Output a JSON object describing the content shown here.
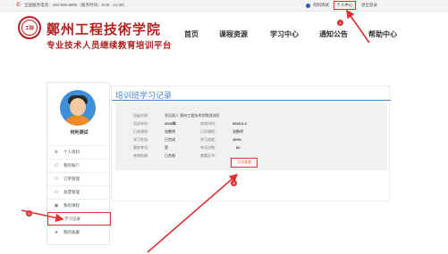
{
  "topbar": {
    "hotline": "全国服务电话：400-900-6896（服务时间：8:00 - 21:00）",
    "username": "何利测试",
    "personal_center": "个人中心",
    "logout": "退出登录"
  },
  "header": {
    "logo_seal_text": "工院",
    "logo_title": "鄭州工程技術学院",
    "logo_subtitle": "专业技术人员继续教育培训平台",
    "nav": [
      "首页",
      "课程资源",
      "学习中心",
      "通知公告",
      "帮助中心"
    ]
  },
  "sidebar": {
    "user_name": "何利测试",
    "menu": [
      {
        "icon": "⚙",
        "label": "个人资料"
      },
      {
        "icon": "⚇",
        "label": "我的账户"
      },
      {
        "icon": "⚇",
        "label": "订单管理"
      },
      {
        "icon": "⚇",
        "label": "发票管理"
      },
      {
        "icon": "▣",
        "label": "我的课程"
      },
      {
        "icon": "✎",
        "label": "学习记录"
      },
      {
        "icon": "★",
        "label": "我的收藏"
      }
    ]
  },
  "main": {
    "title": "培训班学习记录",
    "record": {
      "class_name_label": "班级名称:",
      "class_name_value": "学员双人 郑州工程技术学院测试班",
      "year_label": "培训年份:",
      "year_value": "2023年",
      "end_time_label": "结束时间:",
      "end_time_value": "2023-6-2",
      "required_label": "已选课程:",
      "required_value": "张鹏明",
      "elective_label": "已学课程:",
      "elective_value": "张鹏明",
      "status_label": "学习状态:",
      "status_value": "已完成",
      "progress_label": "学习进度:",
      "progress_value": "100%",
      "exam_label": "题库考试:",
      "exam_value": "是",
      "score_label": "考试分数:",
      "score_value": "60",
      "result_label": "考核结果:",
      "result_value": "已合格",
      "cert_label": "查看证书:",
      "cert_button": "点击查看"
    }
  },
  "annotations": [
    "1",
    "2",
    "3"
  ]
}
